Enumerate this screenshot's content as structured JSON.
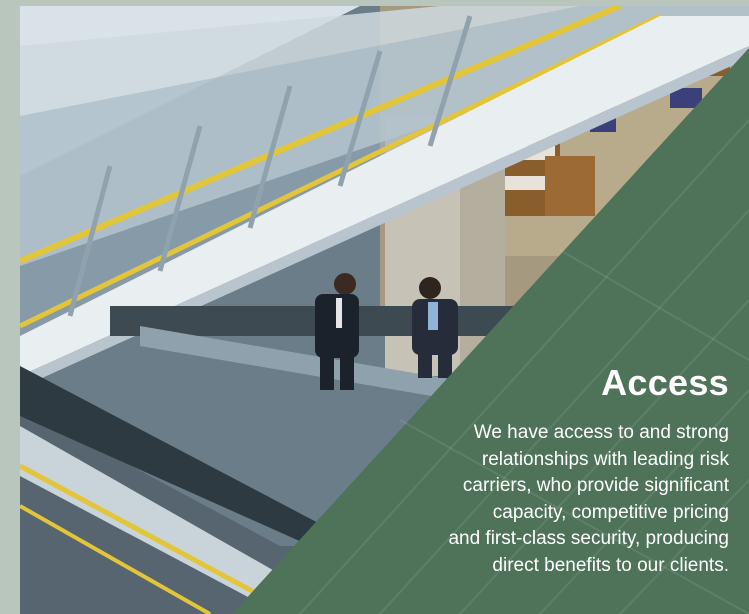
{
  "content": {
    "heading": "Access",
    "body_lines": [
      "We have access to and strong",
      "relationships with leading risk",
      "carriers, who provide significant",
      "capacity, competitive pricing",
      "and first-class security, producing",
      "direct benefits to our clients."
    ]
  },
  "colors": {
    "panel": "#4f7358",
    "frame": "#b9c6bd",
    "text": "#ffffff"
  },
  "photo": {
    "subject": "escalators-with-two-businessmen"
  }
}
